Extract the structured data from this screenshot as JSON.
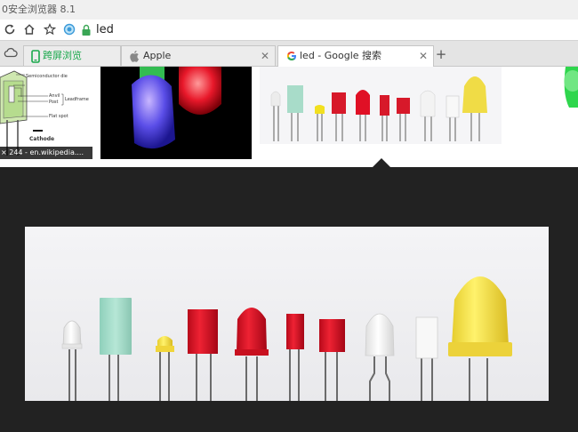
{
  "window": {
    "title": "0安全浏览器 8.1"
  },
  "address_bar": {
    "url": "led"
  },
  "tabs": [
    {
      "label": "跨屏浏览",
      "icon": "phone-icon",
      "color": "#19a84b"
    },
    {
      "label": "Apple",
      "icon": "apple-icon"
    },
    {
      "label": "led - Google 搜索",
      "icon": "google-icon",
      "active": true
    }
  ],
  "thumbnails": {
    "diagram_labels": [
      "Semiconductor die",
      "Anvil",
      "Post",
      "Leadframe",
      "Flat spot",
      "Cathode"
    ],
    "caption": "× 244 - en.wikipedia...."
  },
  "colors": {
    "accent_green": "#19a84b",
    "preview_background": "#222222"
  }
}
